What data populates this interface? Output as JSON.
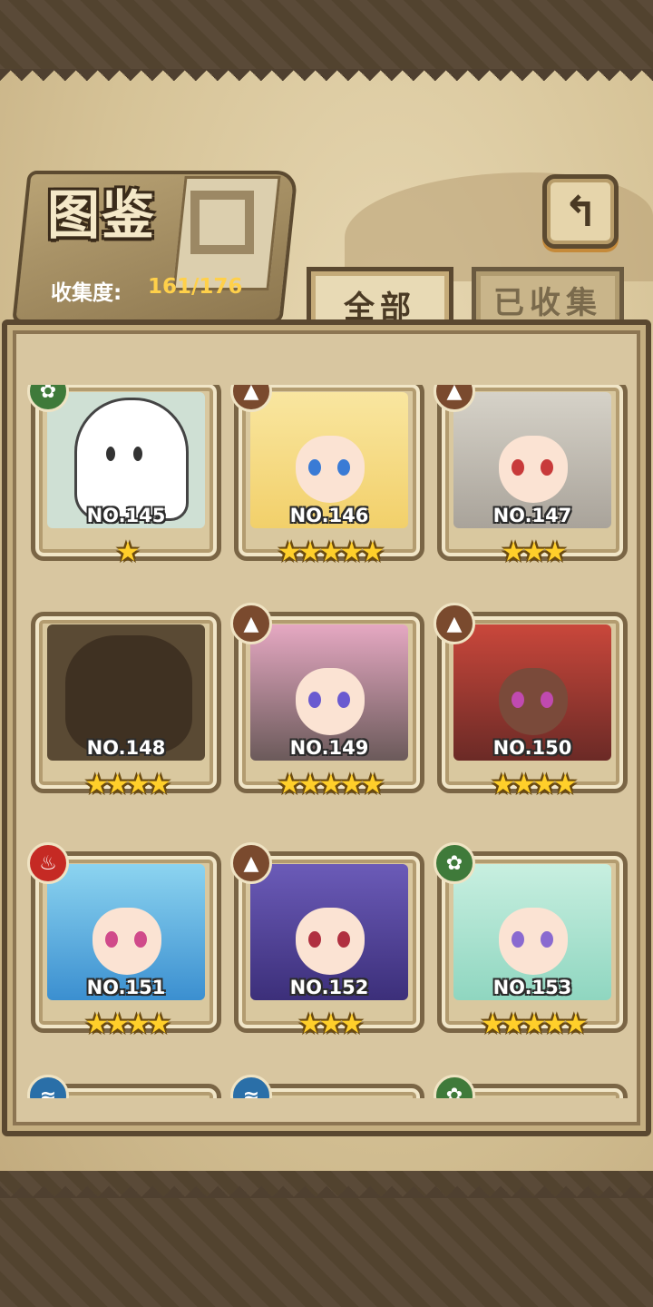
{
  "header": {
    "title": "图鉴",
    "collect_label": "收集度:",
    "collect_value": "161/176",
    "back_icon": "↰"
  },
  "tabs": [
    {
      "label": "全部",
      "active": true
    },
    {
      "label": "已收集",
      "active": false
    }
  ],
  "cards": [
    {
      "no": "NO.145",
      "stars": "★",
      "element": "grass",
      "art": "ghost"
    },
    {
      "no": "NO.146",
      "stars": "★★★★★",
      "element": "earth",
      "art": "blonde"
    },
    {
      "no": "NO.147",
      "stars": "★★★",
      "element": "earth",
      "art": "silver"
    },
    {
      "no": "NO.148",
      "stars": "★★★★",
      "element": "",
      "art": "shadow"
    },
    {
      "no": "NO.149",
      "stars": "★★★★★",
      "element": "earth",
      "art": "pinkhelm"
    },
    {
      "no": "NO.150",
      "stars": "★★★★",
      "element": "earth",
      "art": "redhorn"
    },
    {
      "no": "NO.151",
      "stars": "★★★★",
      "element": "fire",
      "art": "bluehair"
    },
    {
      "no": "NO.152",
      "stars": "★★★",
      "element": "earth",
      "art": "purple"
    },
    {
      "no": "NO.153",
      "stars": "★★★★★",
      "element": "grass",
      "art": "mint"
    }
  ],
  "partial_row_elements": [
    "water",
    "water",
    "grass"
  ]
}
